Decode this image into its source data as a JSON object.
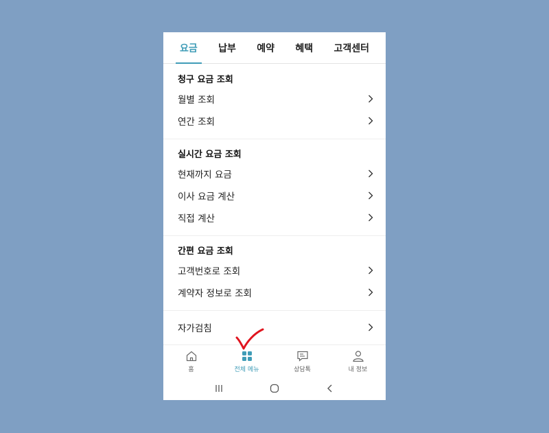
{
  "tabs": [
    {
      "label": "요금"
    },
    {
      "label": "납부"
    },
    {
      "label": "예약"
    },
    {
      "label": "혜택"
    },
    {
      "label": "고객센터"
    }
  ],
  "active_tab": "요금",
  "sections": [
    {
      "title": "청구 요금 조회",
      "items": [
        "월별 조회",
        "연간 조회"
      ]
    },
    {
      "title": "실시간 요금 조회",
      "items": [
        "현재까지 요금",
        "이사 요금 계산",
        "직접 계산"
      ]
    },
    {
      "title": "간편 요금 조회",
      "items": [
        "고객번호로 조회",
        "계약자 정보로 조회"
      ]
    }
  ],
  "extra_item": "자가검침",
  "bottom_nav": [
    {
      "label": "홈",
      "icon": "home-icon"
    },
    {
      "label": "전체 메뉴",
      "icon": "grid-icon"
    },
    {
      "label": "상담톡",
      "icon": "chat-icon"
    },
    {
      "label": "내 정보",
      "icon": "person-icon"
    }
  ],
  "colors": {
    "accent": "#3f9cb7",
    "background": "#7f9fc3",
    "annotation": "#e0141e"
  }
}
